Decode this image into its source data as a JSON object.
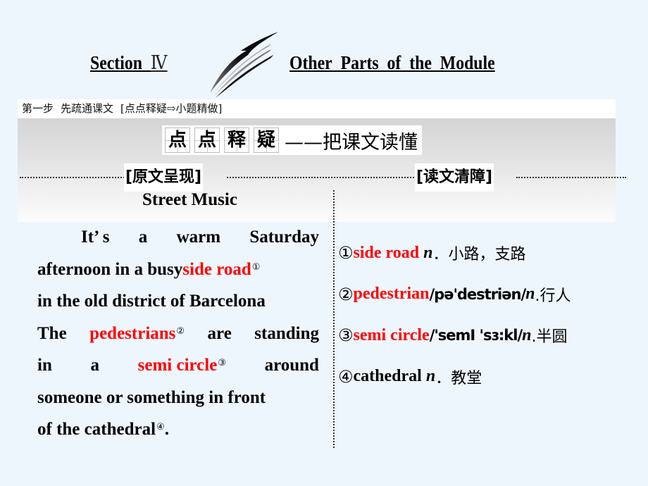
{
  "title": {
    "section_label": "Section",
    "section_number": "Ⅳ",
    "module_title": "Other_Parts_of_the_Module"
  },
  "step_bar": {
    "step": "第一步",
    "step_desc": "先疏通课文",
    "bracket": "[点点释疑⇨小题精做]"
  },
  "heading": {
    "grid_chars": [
      "点",
      "点",
      "释",
      "疑"
    ],
    "subtitle": "——把课文读懂"
  },
  "labels": {
    "left": "[原文呈现]",
    "right": "[读文清障]"
  },
  "passage": {
    "title": "Street Music",
    "lines": [
      {
        "parts": [
          {
            "t": "It’ s"
          },
          {
            "t": "a"
          },
          {
            "t": "warm"
          },
          {
            "t": "Saturday"
          }
        ],
        "style": "indent"
      },
      {
        "parts": [
          {
            "t": "afternoon in a busy "
          },
          {
            "t": "side road",
            "red": true,
            "note": "①"
          }
        ],
        "style": "left"
      },
      {
        "parts": [
          {
            "t": "in the old district of Barcelona"
          }
        ],
        "style": "left"
      },
      {
        "parts": [
          {
            "t": "The"
          },
          {
            "t": "pedestrians",
            "red": true,
            "note": "②"
          },
          {
            "t": "are"
          },
          {
            "t": "standing"
          }
        ],
        "style": "justify"
      },
      {
        "parts": [
          {
            "t": "in"
          },
          {
            "t": "a"
          },
          {
            "t": "semi circle",
            "red": true,
            "note": "③"
          },
          {
            "t": "around"
          }
        ],
        "style": "justify"
      },
      {
        "parts": [
          {
            "t": "someone or something in front"
          }
        ],
        "style": "left"
      },
      {
        "parts": [
          {
            "t": "of the cathedral"
          },
          {
            "t": "④",
            "supOnly": true
          },
          {
            "t": "."
          }
        ],
        "style": "left"
      }
    ]
  },
  "notes": [
    {
      "num": "①",
      "term": "side road",
      "term_red": true,
      "ipa": "",
      "pos": "n",
      "meaning": "．小路，支路"
    },
    {
      "num": "②",
      "term": "pedestrian",
      "term_red": true,
      "ipa": "/pə'destriən/",
      "pos": "n",
      "meaning": ".行人"
    },
    {
      "num": "③",
      "term": "semi circle",
      "term_red": true,
      "ipa": "/'semI 'sɜ:kl/",
      "pos": "n",
      "meaning": ".半圆"
    },
    {
      "num": "④",
      "term": "cathedral",
      "term_red": false,
      "ipa": "",
      "pos": "n",
      "meaning": "．教堂"
    }
  ],
  "colors": {
    "background": "#eef6fd",
    "highlight": "#ff0000",
    "banner_top": "#cfcfcf",
    "banner_bottom": "#fbfbfb"
  }
}
